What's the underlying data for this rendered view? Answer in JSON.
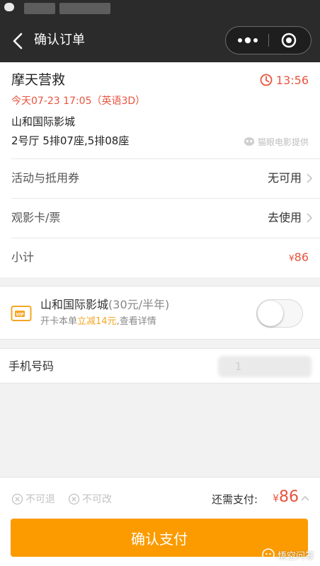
{
  "nav": {
    "title": "确认订单"
  },
  "order": {
    "movie_title": "摩天营救",
    "countdown": "13:56",
    "show_time": "今天07-23 17:05（英语3D）",
    "cinema": "山和国际影城",
    "seats": "2号厅 5排07座,5排08座",
    "provider": "猫眼电影提供"
  },
  "rows": [
    {
      "label": "活动与抵用券",
      "value": "无可用"
    },
    {
      "label": "观影卡/票",
      "value": "去使用"
    },
    {
      "label": "小计",
      "price_symbol": "¥",
      "price": "86"
    }
  ],
  "vip": {
    "title": "山和国际影城",
    "title_sub": "(30元/半年)",
    "desc_prefix": "开卡本单",
    "desc_highlight": "立减14元",
    "desc_suffix": ",查看详情"
  },
  "phone": {
    "label": "手机号码",
    "value": "1"
  },
  "bottom": {
    "policy_1": "不可退",
    "policy_2": "不可改",
    "pay_label": "还需支付:",
    "pay_symbol": "¥",
    "pay_amount": "86",
    "confirm_label": "确认支付"
  },
  "watermark": "悟空问答",
  "colors": {
    "accent": "#fb9b00",
    "price": "#e8543f",
    "nav_bg": "#2b2b2b"
  }
}
